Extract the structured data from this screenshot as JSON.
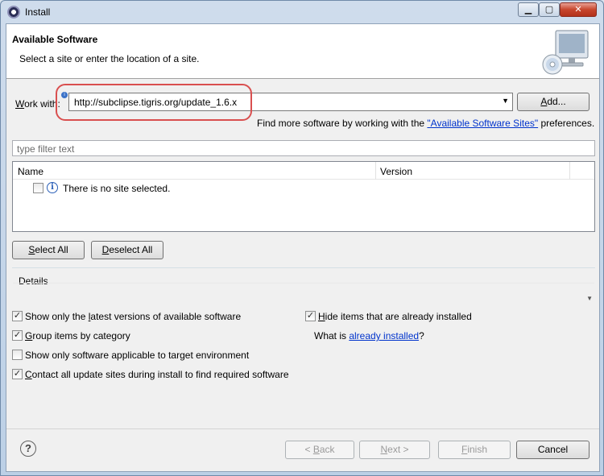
{
  "window": {
    "title": "Install",
    "controls": {
      "minimize": "▁",
      "maximize": "▢",
      "close": "✕"
    }
  },
  "header": {
    "title": "Available Software",
    "subtitle": "Select a site or enter the location of a site."
  },
  "work_with": {
    "label_pre": "",
    "label_accel": "W",
    "label_post": "ork with:",
    "value": "http://subclipse.tigris.org/update_1.6.x",
    "add_accel": "A",
    "add_post": "dd..."
  },
  "find_more": {
    "prefix": "Find more software by working with the ",
    "link": "\"Available Software Sites\"",
    "suffix": " preferences."
  },
  "filter": {
    "placeholder": "type filter text"
  },
  "table": {
    "columns": [
      "Name",
      "Version"
    ],
    "rows": [
      {
        "name": "There is no site selected.",
        "checked": false
      }
    ]
  },
  "buttons": {
    "select_all_accel": "S",
    "select_all_post": "elect All",
    "deselect_all_accel": "D",
    "deselect_all_post": "eselect All"
  },
  "details": {
    "label": "Details"
  },
  "options": {
    "latest": {
      "pre": "Show only the ",
      "accel": "l",
      "post": "atest versions of available software",
      "checked": true
    },
    "group": {
      "pre": "",
      "accel": "G",
      "post": "roup items by category",
      "checked": true
    },
    "target": {
      "pre": "Show only software applicable to target environment",
      "accel": "",
      "post": "",
      "checked": false
    },
    "contact": {
      "pre": "",
      "accel": "C",
      "post": "ontact all update sites during install to find required software",
      "checked": true
    },
    "hide": {
      "pre": "",
      "accel": "H",
      "post": "ide items that are already installed",
      "checked": true
    },
    "what_is_prefix": "What is ",
    "what_is_link": "already installed",
    "what_is_suffix": "?"
  },
  "footer": {
    "help": "?",
    "back_pre": "< ",
    "back_accel": "B",
    "back_post": "ack",
    "next_accel": "N",
    "next_post": "ext >",
    "finish_accel": "F",
    "finish_post": "inish",
    "cancel": "Cancel"
  },
  "icons": {
    "check": "✓",
    "info": "i",
    "combo_arrow": "▼"
  },
  "colors": {
    "link": "#0033cc",
    "highlight": "#d94f4f"
  }
}
